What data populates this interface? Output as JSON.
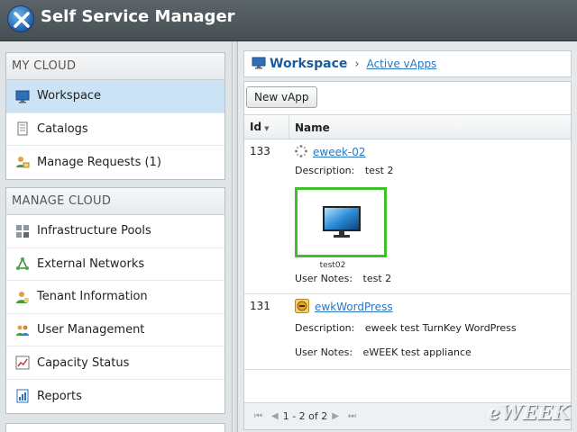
{
  "app": {
    "title": "Self Service Manager"
  },
  "sidebar": {
    "my_cloud": {
      "heading": "MY CLOUD",
      "items": [
        {
          "label": "Workspace",
          "icon": "monitor-icon",
          "active": true
        },
        {
          "label": "Catalogs",
          "icon": "document-icon"
        },
        {
          "label": "Manage Requests (1)",
          "icon": "user-mail-icon"
        }
      ]
    },
    "manage_cloud": {
      "heading": "MANAGE CLOUD",
      "items": [
        {
          "label": "Infrastructure Pools",
          "icon": "grid-icon"
        },
        {
          "label": "External Networks",
          "icon": "network-icon"
        },
        {
          "label": "Tenant Information",
          "icon": "user-icon"
        },
        {
          "label": "User Management",
          "icon": "users-icon"
        },
        {
          "label": "Capacity Status",
          "icon": "chart-icon"
        },
        {
          "label": "Reports",
          "icon": "report-icon"
        }
      ]
    }
  },
  "breadcrumb": {
    "home": "Workspace",
    "current": "Active vApps"
  },
  "toolbar": {
    "new_vapp": "New vApp"
  },
  "table": {
    "columns": {
      "id": "Id",
      "name": "Name"
    },
    "rows": [
      {
        "id": "133",
        "name": "eweek-02",
        "description_label": "Description:",
        "description": "test 2",
        "thumb_label": "test02",
        "notes_label": "User Notes:",
        "notes": "test 2"
      },
      {
        "id": "131",
        "name": "ewkWordPress",
        "description_label": "Description:",
        "description": "eweek test TurnKey WordPress",
        "notes_label": "User Notes:",
        "notes": "eWEEK test appliance"
      }
    ]
  },
  "pager": {
    "text": "1 - 2 of 2"
  },
  "watermark": "eWEEK",
  "colors": {
    "title_bar": "#4f595d",
    "active_nav": "#cbe3f4",
    "link": "#2a76c0",
    "thumb_border": "#3fbf2a"
  }
}
